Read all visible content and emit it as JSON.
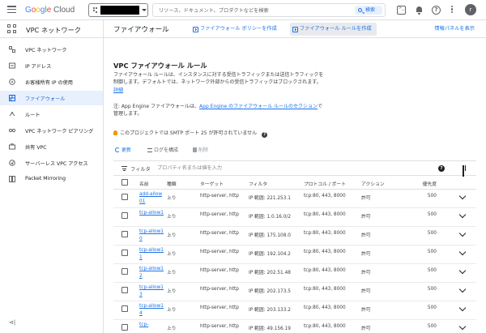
{
  "topbar": {
    "logo_parts": [
      "G",
      "o",
      "o",
      "g",
      "l",
      "e"
    ],
    "logo_cloud": "Cloud",
    "search_placeholder": "リソース、ドキュメント、プロダクトなどを検索",
    "search_button": "検索",
    "avatar_initial": "r"
  },
  "sidebar": {
    "title": "VPC ネットワーク",
    "items": [
      {
        "label": "VPC ネットワーク",
        "icon": "vpc-network-icon",
        "active": false
      },
      {
        "label": "IP アドレス",
        "icon": "ip-address-icon",
        "active": false
      },
      {
        "label": "お客様所有 IP の使用",
        "icon": "byoip-icon",
        "active": false
      },
      {
        "label": "ファイアウォール",
        "icon": "firewall-icon",
        "active": true
      },
      {
        "label": "ルート",
        "icon": "route-icon",
        "active": false
      },
      {
        "label": "VPC ネットワーク ピアリング",
        "icon": "peering-icon",
        "active": false
      },
      {
        "label": "共有 VPC",
        "icon": "shared-vpc-icon",
        "active": false
      },
      {
        "label": "サーバーレス VPC アクセス",
        "icon": "serverless-icon",
        "active": false
      },
      {
        "label": "Packet Mirroring",
        "icon": "packet-mirroring-icon",
        "active": false
      }
    ],
    "collapse_glyph": "⊲|"
  },
  "header": {
    "page_title": "ファイアウォール",
    "create_policy": "ファイアウォール ポリシーを作成",
    "create_rule": "ファイアウォール ルールを作成",
    "info_panel": "情報パネルを表示"
  },
  "main": {
    "heading": "VPC ファイアウォール ルール",
    "description": "ファイアウォール ルールは、インスタンスに対する受信トラフィックまたは送信トラフィックを制御します。デフォルトでは、ネットワーク外部からの受信トラフィックはブロックされます。",
    "details_link": "詳細",
    "note_prefix": "注: App Engine ファイアウォールは、",
    "note_link": "App Engine のファイアウォール ルールのセクション",
    "note_suffix": "で管理します。",
    "smtp_notice": "このプロジェクトでは SMTP ポート 25 が許可されていません",
    "toolbar": {
      "refresh": "更新",
      "logs": "ログを構成",
      "delete": "削除"
    },
    "filter_label": "フィルタ",
    "filter_placeholder": "プロパティ名または値を入力",
    "columns": {
      "name": "名前",
      "direction": "種類",
      "targets": "ターゲット",
      "filters": "フィルタ",
      "protocols": "プロトコル / ポート",
      "action": "アクション",
      "priority": "優先度"
    },
    "rows": [
      {
        "name": "add-allow01",
        "direction": "上り",
        "targets": "http-server, http",
        "filters": "IP 範囲: 221.253.1",
        "protocols": "tcp:80, 443, 8000",
        "action": "許可",
        "priority": "500"
      },
      {
        "name": "tcp-allow1",
        "direction": "上り",
        "targets": "http-server, http",
        "filters": "IP 範囲: 1.0.16.0/2",
        "protocols": "tcp:80, 443, 8000",
        "action": "許可",
        "priority": "500"
      },
      {
        "name": "tcp-allow10",
        "direction": "上り",
        "targets": "http-server, http",
        "filters": "IP 範囲: 175.108.0",
        "protocols": "tcp:80, 443, 8000",
        "action": "許可",
        "priority": "500"
      },
      {
        "name": "tcp-allow11",
        "direction": "上り",
        "targets": "http-server, http",
        "filters": "IP 範囲: 192.104.2",
        "protocols": "tcp:80, 443, 8000",
        "action": "許可",
        "priority": "500"
      },
      {
        "name": "tcp-allow12",
        "direction": "上り",
        "targets": "http-server, http",
        "filters": "IP 範囲: 202.51.48",
        "protocols": "tcp:80, 443, 8000",
        "action": "許可",
        "priority": "500"
      },
      {
        "name": "tcp-allow13",
        "direction": "上り",
        "targets": "http-server, http",
        "filters": "IP 範囲: 202.173.5",
        "protocols": "tcp:80, 443, 8000",
        "action": "許可",
        "priority": "500"
      },
      {
        "name": "tcp-allow14",
        "direction": "上り",
        "targets": "http-server, http",
        "filters": "IP 範囲: 203.133.2",
        "protocols": "tcp:80, 443, 8000",
        "action": "許可",
        "priority": "500"
      },
      {
        "name": "tcp-",
        "direction": "上り",
        "targets": "http-server, http",
        "filters": "IP 範囲: 49.156.19",
        "protocols": "tcp:80, 443, 8000",
        "action": "許可",
        "priority": "500"
      }
    ]
  },
  "colors": {
    "accent": "#1a73e8",
    "active_bg": "#e8f0fe",
    "text": "#202124",
    "muted": "#5f6368"
  }
}
